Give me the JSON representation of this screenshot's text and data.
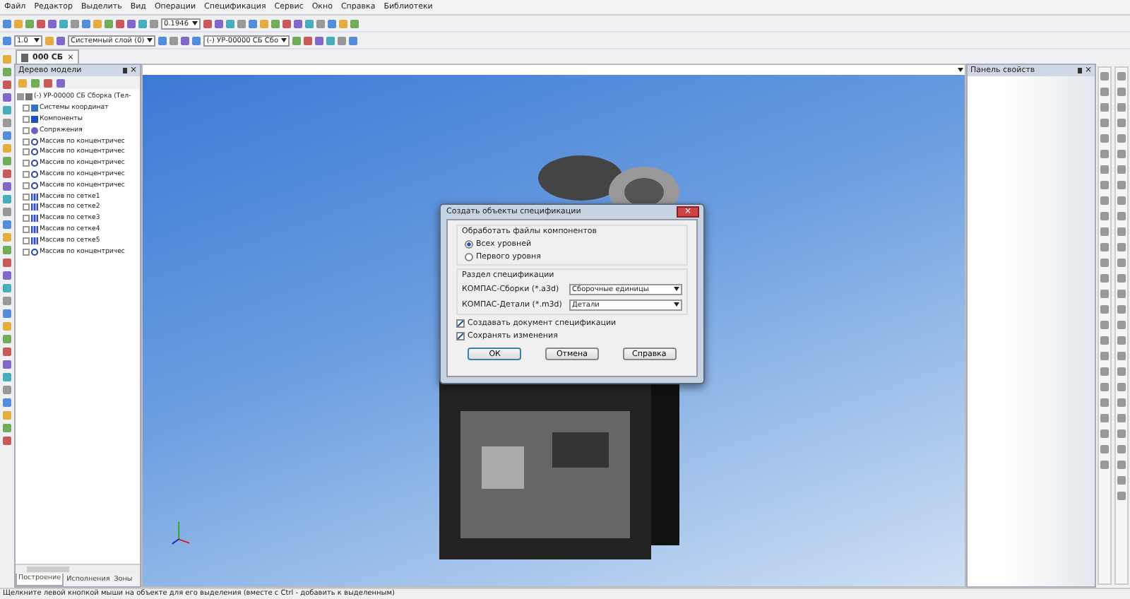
{
  "menu": [
    {
      "label": "Файл"
    },
    {
      "label": "Редактор"
    },
    {
      "label": "Выделить"
    },
    {
      "label": "Вид"
    },
    {
      "label": "Операции"
    },
    {
      "label": "Спецификация"
    },
    {
      "label": "Сервис"
    },
    {
      "label": "Окно"
    },
    {
      "label": "Справка"
    },
    {
      "label": "Библиотеки"
    }
  ],
  "toolbar": {
    "zoom": "0.1946",
    "scale": "1.0",
    "layer": "Системный слой (0)",
    "document": "(-) УР-00000 СБ Сбо"
  },
  "document_tab": {
    "title": "000 СБ",
    "close": "×"
  },
  "tree_panel": {
    "title": "Дерево модели",
    "close": "×",
    "root": {
      "label": "(-) УР-00000 СБ Сборка (Тел-",
      "expanded": true,
      "children": [
        {
          "label": "Системы координат",
          "kind": "axes"
        },
        {
          "label": "Компоненты",
          "kind": "components"
        },
        {
          "label": "Сопряжения",
          "kind": "mates"
        },
        {
          "label": "Массив по концентричес",
          "kind": "circular"
        },
        {
          "label": "Массив по концентричес",
          "kind": "circular"
        },
        {
          "label": "Массив по концентричес",
          "kind": "circular"
        },
        {
          "label": "Массив по концентричес",
          "kind": "circular"
        },
        {
          "label": "Массив по концентричес",
          "kind": "circular"
        },
        {
          "label": "Массив по сетке1",
          "kind": "grid"
        },
        {
          "label": "Массив по сетке2",
          "kind": "grid"
        },
        {
          "label": "Массив по сетке3",
          "kind": "grid"
        },
        {
          "label": "Массив по сетке4",
          "kind": "grid"
        },
        {
          "label": "Массив по сетке5",
          "kind": "grid"
        },
        {
          "label": "Массив по концентричес",
          "kind": "circular"
        }
      ]
    },
    "tabs": [
      {
        "label": "Построение",
        "selected": true
      },
      {
        "label": "Исполнения",
        "selected": false
      },
      {
        "label": "Зоны",
        "selected": false
      }
    ]
  },
  "properties_panel": {
    "title": "Панель свойств",
    "close": "×"
  },
  "dialog": {
    "title": "Создать объекты спецификации",
    "close": "×",
    "components_group": {
      "title": "Обработать файлы компонентов",
      "options": [
        {
          "label": "Всех уровней",
          "selected": true
        },
        {
          "label": "Первого уровня",
          "selected": false
        }
      ]
    },
    "section_group": {
      "title": "Раздел спецификации",
      "rows": [
        {
          "label": "КОМПАС-Сборки (*.a3d)",
          "value": "Сборочные единицы"
        },
        {
          "label": "КОМПАС-Детали (*.m3d)",
          "value": "Детали"
        }
      ]
    },
    "checkboxes": [
      {
        "label": "Создавать документ спецификации",
        "checked": true
      },
      {
        "label": "Сохранять изменения",
        "checked": true
      }
    ],
    "buttons": [
      {
        "label": "ОК",
        "default": true
      },
      {
        "label": "Отмена",
        "default": false
      },
      {
        "label": "Справка",
        "default": false
      }
    ]
  },
  "status_bar": {
    "text": "Щелкните левой кнопкой мыши на объекте для его выделения (вместе с Ctrl - добавить к выделенным)"
  }
}
